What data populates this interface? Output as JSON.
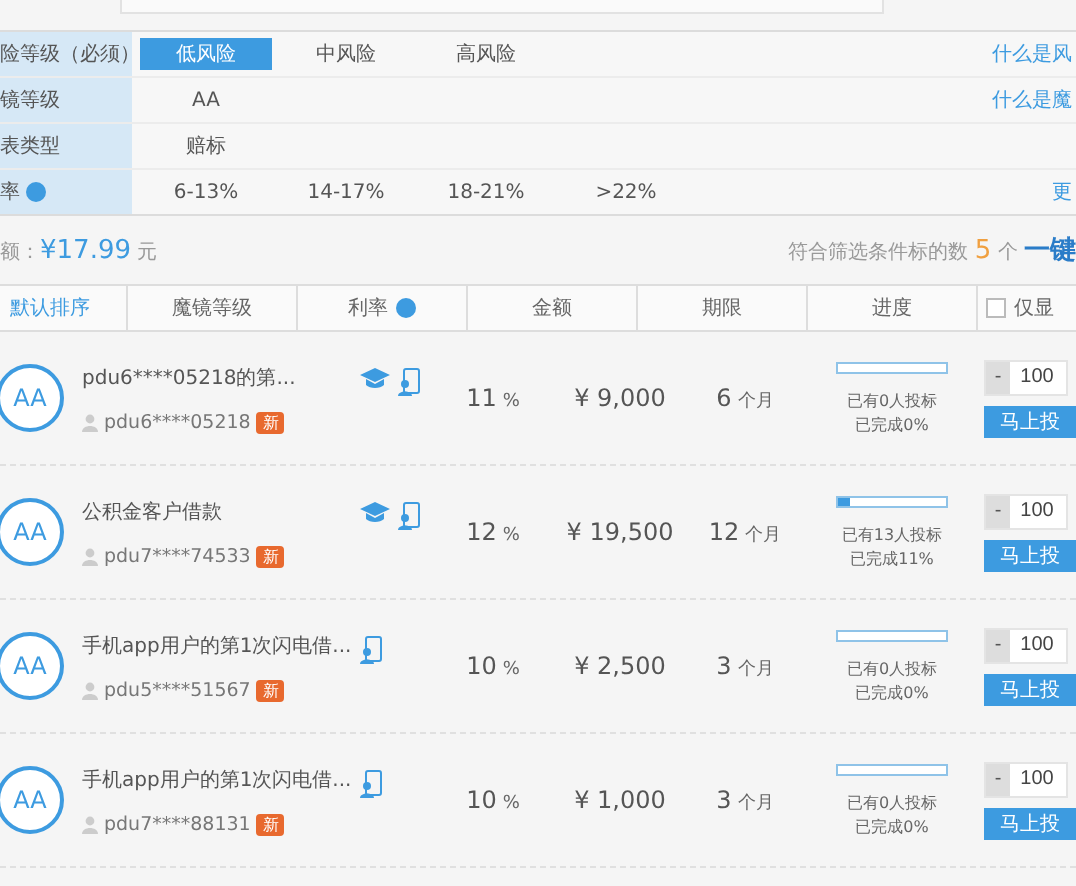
{
  "filters": [
    {
      "label": "险等级（必须）",
      "has_help": false,
      "options": [
        {
          "label": "低风险",
          "selected": true
        },
        {
          "label": "中风险",
          "selected": false
        },
        {
          "label": "高风险",
          "selected": false
        }
      ],
      "link": "什么是风"
    },
    {
      "label": "镜等级",
      "has_help": false,
      "options": [
        {
          "label": "AA",
          "selected": false
        }
      ],
      "link": "什么是魔"
    },
    {
      "label": "表类型",
      "has_help": false,
      "options": [
        {
          "label": "赔标",
          "selected": false
        }
      ]
    },
    {
      "label": "率",
      "has_help": true,
      "options": [
        {
          "label": "6-13%",
          "selected": false
        },
        {
          "label": "14-17%",
          "selected": false
        },
        {
          "label": "18-21%",
          "selected": false
        },
        {
          "label": ">22%",
          "selected": false
        }
      ],
      "link": "更"
    }
  ],
  "summary": {
    "balance_label": "额：",
    "balance": "¥17.99",
    "balance_unit": "元",
    "count_label": "符合筛选条件标的数",
    "count": "5",
    "count_unit": "个",
    "action": "一键"
  },
  "columns": [
    {
      "label": "默认排序",
      "kind": "sort"
    },
    {
      "label": "魔镜等级",
      "kind": "plain"
    },
    {
      "label": "利率",
      "kind": "help"
    },
    {
      "label": "金额",
      "kind": "plain"
    },
    {
      "label": "期限",
      "kind": "plain"
    },
    {
      "label": "进度",
      "kind": "plain"
    },
    {
      "label": "仅显",
      "kind": "check",
      "checked": false
    }
  ],
  "rows": [
    {
      "grade": "AA",
      "title": "pdu6****05218的第...",
      "user": "pdu6****05218",
      "tag": "新",
      "education": true,
      "mobile": true,
      "rate": "11",
      "rate_unit": "%",
      "amount": "¥ 9,000",
      "term": "6",
      "term_unit": "个月",
      "level": 0,
      "bidders": "已有0人投标",
      "done": "已完成0%",
      "qty": "100",
      "minus": "-",
      "button": "马上投"
    },
    {
      "grade": "AA",
      "title": "公积金客户借款",
      "user": "pdu7****74533",
      "tag": "新",
      "education": true,
      "mobile": true,
      "rate": "12",
      "rate_unit": "%",
      "amount": "¥ 19,500",
      "term": "12",
      "term_unit": "个月",
      "level": 0.11,
      "bidders": "已有13人投标",
      "done": "已完成11%",
      "qty": "100",
      "minus": "-",
      "button": "马上投"
    },
    {
      "grade": "AA",
      "title": "手机app用户的第1次闪电借...",
      "user": "pdu5****51567",
      "tag": "新",
      "education": false,
      "mobile": true,
      "rate": "10",
      "rate_unit": "%",
      "amount": "¥ 2,500",
      "term": "3",
      "term_unit": "个月",
      "level": 0,
      "bidders": "已有0人投标",
      "done": "已完成0%",
      "qty": "100",
      "minus": "-",
      "button": "马上投"
    },
    {
      "grade": "AA",
      "title": "手机app用户的第1次闪电借...",
      "user": "pdu7****88131",
      "tag": "新",
      "education": false,
      "mobile": true,
      "rate": "10",
      "rate_unit": "%",
      "amount": "¥ 1,000",
      "term": "3",
      "term_unit": "个月",
      "level": 0,
      "bidders": "已有0人投标",
      "done": "已完成0%",
      "qty": "100",
      "minus": "-",
      "button": "马上投"
    }
  ]
}
